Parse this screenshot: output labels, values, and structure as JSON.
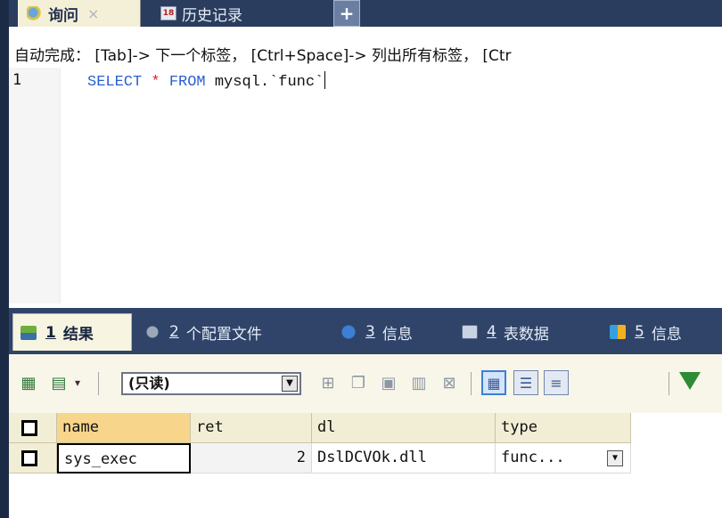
{
  "tabs": {
    "query_label": "询问",
    "close_glyph": "×",
    "history_label": "历史记录",
    "history_icon_text": "18",
    "add_glyph": "+"
  },
  "hint": "自动完成： [Tab]-> 下一个标签， [Ctrl+Space]-> 列出所有标签， [Ctr",
  "editor": {
    "line_number": "1",
    "kw_select": "SELECT",
    "star": "*",
    "kw_from": "FROM",
    "table": "mysql.`func`"
  },
  "result_tabs": [
    {
      "num": "1",
      "label": "结果",
      "icon": "grid-icon"
    },
    {
      "num": "2",
      "label": "个配置文件",
      "icon": "profile-icon"
    },
    {
      "num": "3",
      "label": "信息",
      "icon": "info-icon"
    },
    {
      "num": "4",
      "label": "表数据",
      "icon": "table-icon"
    },
    {
      "num": "5",
      "label": "信息",
      "icon": "info-color-icon"
    }
  ],
  "toolbar": {
    "mode_select": "(只读)"
  },
  "grid": {
    "columns": [
      "name",
      "ret",
      "dl",
      "type"
    ],
    "rows": [
      {
        "name": "sys_exec",
        "ret": "2",
        "dl": "DslDCVOk.dll",
        "type": "func..."
      }
    ]
  },
  "colors": {
    "tab_bar": "#2a3d5e",
    "keyword": "#2a5fd0",
    "operator": "#d8262c",
    "active_header": "#f7d58a"
  }
}
